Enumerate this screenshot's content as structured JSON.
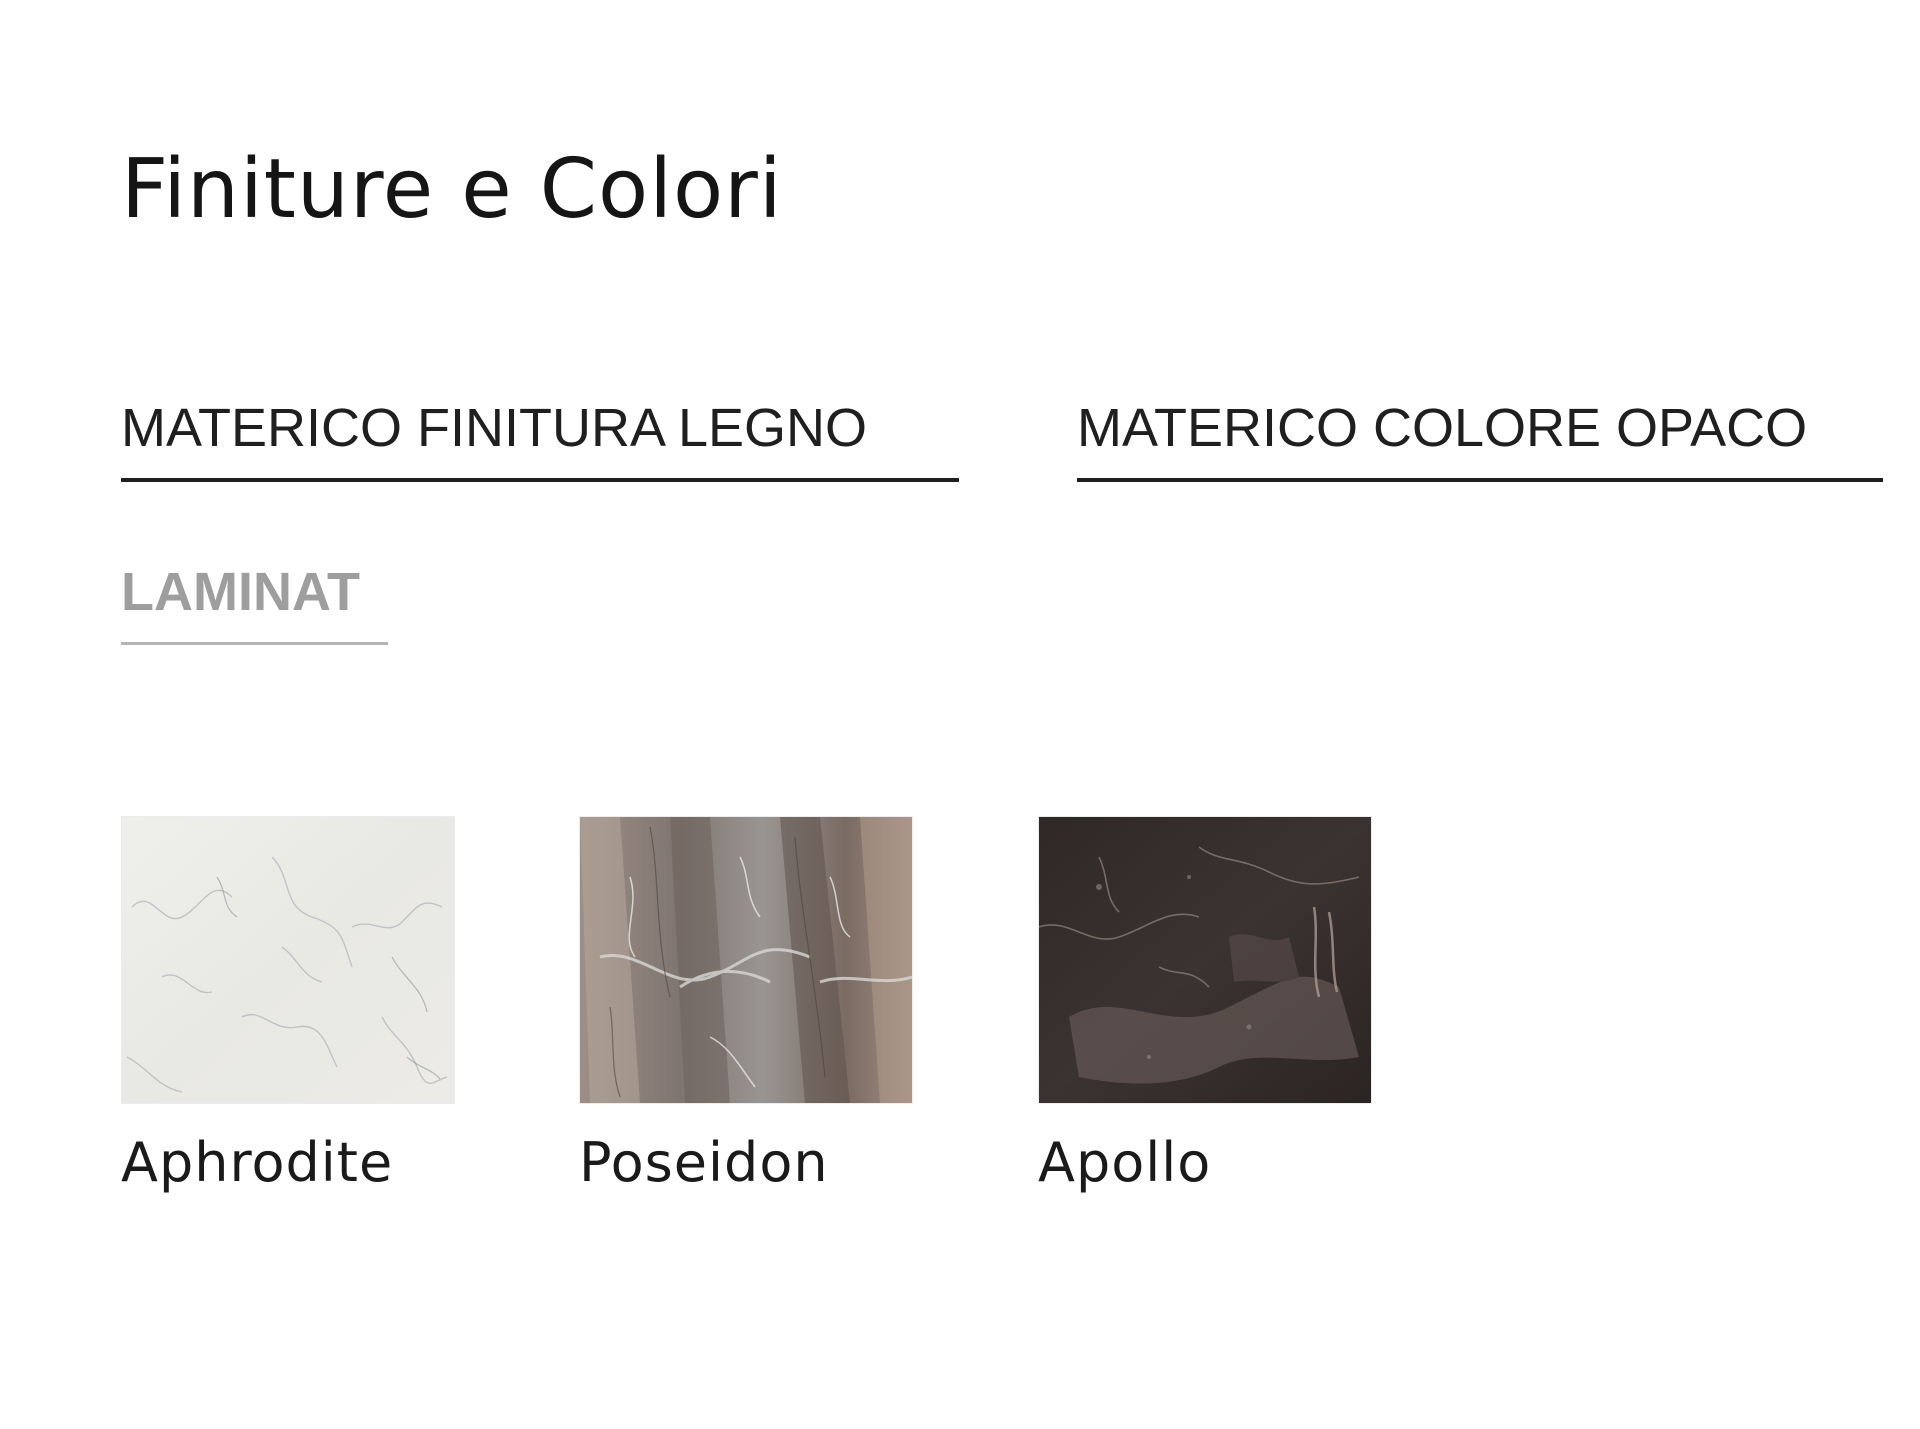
{
  "section": {
    "title": "Finiture e Colori"
  },
  "tabs": [
    {
      "label": "MATERICO FINITURA LEGNO"
    },
    {
      "label": "MATERICO COLORE OPACO"
    },
    {
      "label": "LAMINAT"
    }
  ],
  "swatches": [
    {
      "label": "Aphrodite",
      "texture": "white-marble",
      "color": "#ecece8"
    },
    {
      "label": "Poseidon",
      "texture": "grey-brown-marble",
      "color": "#8f8580"
    },
    {
      "label": "Apollo",
      "texture": "dark-brown-marble",
      "color": "#3a3230"
    }
  ]
}
